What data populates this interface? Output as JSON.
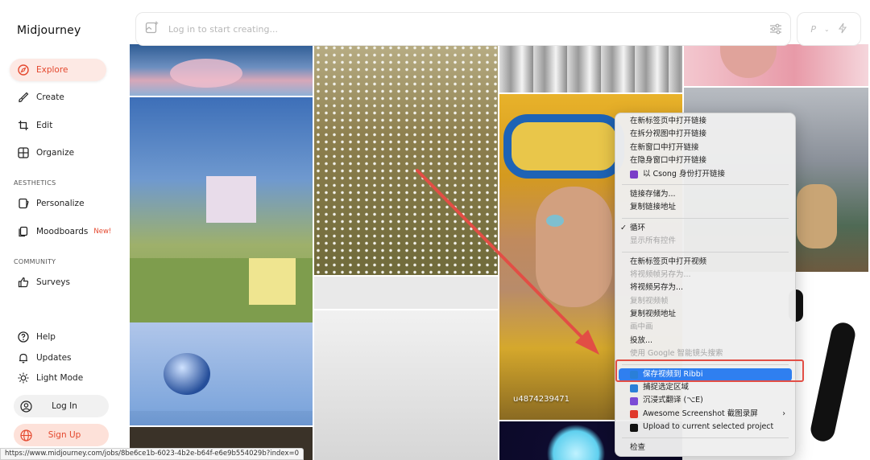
{
  "app": {
    "title": "Midjourney"
  },
  "nav": {
    "explore": "Explore",
    "create": "Create",
    "edit": "Edit",
    "organize": "Organize",
    "personalize": "Personalize",
    "moodboards": "Moodboards",
    "moodboards_badge": "New!",
    "surveys": "Surveys"
  },
  "sections": {
    "aesthetics": "AESTHETICS",
    "community": "COMMUNITY"
  },
  "bottom": {
    "help": "Help",
    "updates": "Updates",
    "light_mode": "Light Mode",
    "login": "Log In",
    "signup": "Sign Up"
  },
  "prompt": {
    "placeholder": "Log in to start creating..."
  },
  "topright": {
    "letter": "P"
  },
  "username": "u4874239471",
  "context_menu": [
    {
      "label": "在新标签页中打开链接",
      "state": "normal"
    },
    {
      "label": "在拆分视图中打开链接",
      "state": "normal"
    },
    {
      "label": "在新窗口中打开链接",
      "state": "normal"
    },
    {
      "label": "在隐身窗口中打开链接",
      "state": "normal"
    },
    {
      "label": "以 Csong 身份打开链接",
      "state": "normal",
      "icon": "profile-icon",
      "icon_color": "#7a3cc8"
    },
    {
      "sep": true
    },
    {
      "label": "链接存储为...",
      "state": "normal"
    },
    {
      "label": "复制链接地址",
      "state": "normal"
    },
    {
      "sep": true
    },
    {
      "label": "循环",
      "state": "checked"
    },
    {
      "label": "显示所有控件",
      "state": "disabled"
    },
    {
      "sep": true
    },
    {
      "label": "在新标签页中打开视频",
      "state": "normal"
    },
    {
      "label": "将视频帧另存为...",
      "state": "disabled"
    },
    {
      "label": "将视频另存为...",
      "state": "normal"
    },
    {
      "label": "复制视频帧",
      "state": "disabled"
    },
    {
      "label": "复制视频地址",
      "state": "normal"
    },
    {
      "label": "画中画",
      "state": "disabled"
    },
    {
      "label": "投放...",
      "state": "normal"
    },
    {
      "label": "使用 Google 智能镜头搜索",
      "state": "disabled"
    },
    {
      "sep": true
    },
    {
      "label": "保存视频到 Ribbi",
      "state": "highlighted",
      "icon": "ribbi-icon",
      "icon_color": "#2a7fd8"
    },
    {
      "label": "捕捉选定区域",
      "state": "normal",
      "icon": "capture-icon",
      "icon_color": "#2a7fd8"
    },
    {
      "label": "沉浸式翻译 (⌥E)",
      "state": "normal",
      "icon": "translate-icon",
      "icon_color": "#7b4bd6"
    },
    {
      "label": "Awesome Screenshot 截图录屏",
      "state": "submenu",
      "icon": "awesome-screenshot-icon",
      "icon_color": "#e0392b"
    },
    {
      "label": "Upload to current selected project",
      "state": "normal",
      "icon": "upload-icon",
      "icon_color": "#111111"
    },
    {
      "sep": true
    },
    {
      "label": "检查",
      "state": "normal"
    }
  ],
  "status_bar": {
    "url": "https://www.midjourney.com/jobs/8be6ce1b-6023-4b2e-b64f-e6e9b554029b?index=0"
  },
  "colors": {
    "accent": "#e4482e",
    "highlight": "#2f7ff0",
    "annotation": "#e24e45"
  }
}
